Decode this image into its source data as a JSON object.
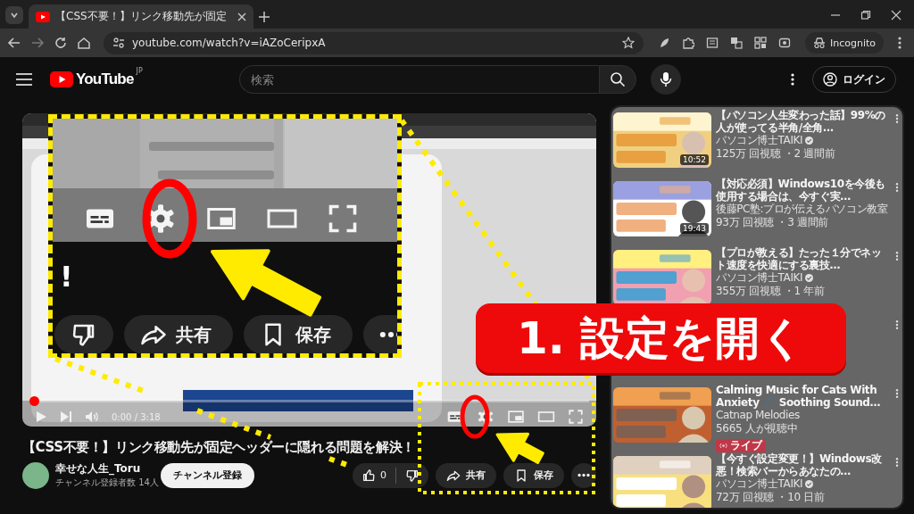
{
  "browser": {
    "tab": {
      "title": "【CSS不要！】リンク移動先が固定",
      "selected": true
    },
    "url": "youtube.com/watch?v=iAZoCeripxA",
    "profile": "Incognito"
  },
  "header": {
    "logo": "YouTube",
    "region": "JP",
    "search": {
      "placeholder": "検索"
    },
    "login": "ログイン"
  },
  "player": {
    "level": 0,
    "time": "0:00 / 3:18"
  },
  "video": {
    "title": "【CSS不要！】リンク移動先が固定ヘッダーに隠れる問題を解決！",
    "channel": "幸せな人生_Toru",
    "subscribers": "チャンネル登録者数 14人",
    "subscribe": "チャンネル登録",
    "likes": "0",
    "share": "共有",
    "save": "保存"
  },
  "sidebar": {
    "items": [
      {
        "kind": "video",
        "title": "【パソコン人生変わった話】99%の人が使ってる半角/全角…",
        "channel": "パソコン博士TAIKI",
        "verified": true,
        "meta": "125万 回視聴 ・2 週間前",
        "duration": "10:52"
      },
      {
        "kind": "video",
        "title": "【対応必須】Windows10を今後も使用する場合は、今すぐ実…",
        "channel": "後藤PC塾:プロが伝えるパソコン教室",
        "verified": false,
        "meta": "93万 回視聴 ・3 週間前",
        "duration": "19:43"
      },
      {
        "kind": "video",
        "title": "【プロが教える】たった１分でネット速度を快適にする裏技…",
        "channel": "パソコン博士TAIKI",
        "verified": true,
        "meta": "355万 回視聴 ・1 年前"
      },
      {
        "kind": "covered"
      },
      {
        "kind": "live",
        "title": "Calming Music for Cats With Anxiety 🎵 Soothing Sound…",
        "channel": "Catnap Melodies",
        "verified": false,
        "meta": "5665 人が視聴中",
        "badge": "ライブ"
      },
      {
        "kind": "video",
        "title": "【今すぐ設定変更！】Windows改悪！検索バーからあなたの…",
        "channel": "パソコン博士TAIKI",
        "verified": true,
        "meta": "72万 回視聴 ・10 日前"
      }
    ]
  },
  "annotation": {
    "step": "1. 設定を開く",
    "inset": {
      "title_end": "!",
      "buttons": [
        {
          "kind": "dislike"
        },
        {
          "kind": "share",
          "label": "共有"
        },
        {
          "kind": "save",
          "label": "保存"
        },
        {
          "kind": "more"
        }
      ]
    }
  }
}
